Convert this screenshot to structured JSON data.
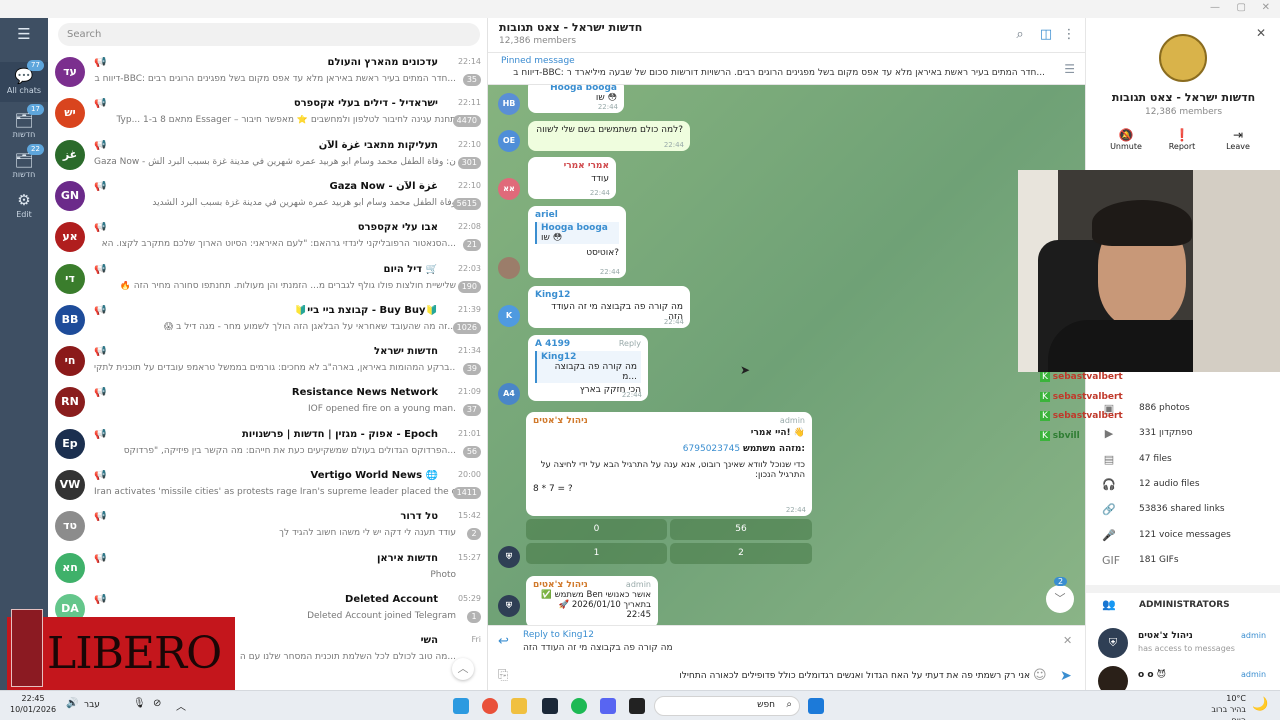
{
  "rail": {
    "items": [
      {
        "label": "All chats",
        "badge": "77"
      },
      {
        "label": "חדשות",
        "badge": "17"
      },
      {
        "label": "חדשות",
        "badge": "22"
      },
      {
        "label": "Edit",
        "badge": ""
      }
    ]
  },
  "search": {
    "placeholder": "Search"
  },
  "chats": [
    {
      "name": "עדכונים מהארץ והעולם",
      "msg": "דיווח ב-BBC: חדר המתים בעיר ראשת באיראן מלא עד אפס מקום בשל מפגינים הרוגים רבים...",
      "time": "22:14",
      "badge": "35",
      "color": "#7b2f8e",
      "initial": "עד"
    },
    {
      "name": "ישראדיל - דילים בעלי אקספרס",
      "msg": "Typ... מתאם 8 ב-1 Essager – תחנת עגינה לחיבור לטלפון ולמחשבים ⭐ מאפשר חיבור",
      "time": "22:11",
      "badge": "4470",
      "color": "#d9441e",
      "initial": "יש"
    },
    {
      "name": "תעליקות מתאבי غزة الآن",
      "msg": "Gaza Now - غزة الآن: وفاة الطفل محمد وسام أبو هربيد عمره شهرين في مدينة غزة بسبب البرد الش...",
      "time": "22:10",
      "badge": "301",
      "color": "#2b6b2b",
      "initial": "غز"
    },
    {
      "name": "Gaza Now - غزة الآن",
      "msg": "وفاة الطفل محمد وسام أبو هربيد عمره شهرين في مدينة غزة بسبب البرد الشديد",
      "time": "22:10",
      "badge": "5615",
      "color": "#6b2a8a",
      "initial": "GN"
    },
    {
      "name": "אבו עלי אקספרס",
      "msg": "הסנאטור הרפובליקני לינדזי גרהאם: \"לעם האיראני: הסיוט הארוך שלכם מתקרב לקצו. הא...",
      "time": "22:08",
      "badge": "21",
      "color": "#b01e1e",
      "initial": "אע"
    },
    {
      "name": "דיל היום 🛒",
      "msg": "🔥 שלישיית חולצות פולו גולף לגברים מ... הזמנתי והן מעולות. תחנתפו סחורה מחיר הזה",
      "time": "22:03",
      "badge": "190",
      "color": "#3a7d2c",
      "initial": "די"
    },
    {
      "name": "🔰קבוצת ביי ביי - Buy Buy🔰",
      "msg": "😱 זה מה שהעובד שאחראי על הבלאגן הזה הולך לשמוע מחר - מגה דיל ב...",
      "time": "21:39",
      "badge": "1026",
      "color": "#1e4c9a",
      "initial": "BB"
    },
    {
      "name": "חדשות ישראל",
      "msg": "ברקע המהומות באיראן, בארה\"ב לא מחכים: גורמים בממשל טראמפ עובדים על תוכנית לתקי...",
      "time": "21:34",
      "badge": "39",
      "color": "#8b1a1a",
      "initial": "חי"
    },
    {
      "name": "Resistance News Network",
      "msg": "IOF opened fire on a young man.",
      "time": "21:09",
      "badge": "37",
      "color": "#8a1d1d",
      "initial": "RN"
    },
    {
      "name": "אפוק - מגזין | חדשות | פרשנויות - Epoch",
      "msg": "הפרדוקס הגדולים בעולם שמשקיעים כעת את חייהם: מה הקשר בין פיזיקה, \"פרדוקס...",
      "time": "21:01",
      "badge": "56",
      "color": "#1b2f4f",
      "initial": "Ep"
    },
    {
      "name": "Vertigo World News 🌐",
      "msg": "Iran activates 'missile cities' as protests rage Iran's supreme leader placed the countr...",
      "time": "20:00",
      "badge": "1411",
      "color": "#333333",
      "initial": "VW"
    },
    {
      "name": "טל דרור",
      "msg": "עודד תענה לי דקה יש לי משהו חשוב להגיד לך",
      "time": "15:42",
      "badge": "2",
      "color": "#8c8c8c",
      "initial": "טד"
    },
    {
      "name": "חדשות איראן",
      "msg": "Photo",
      "time": "15:27",
      "badge": "",
      "color": "#3fb16a",
      "initial": "חא"
    },
    {
      "name": "Deleted Account",
      "msg": "Deleted Account joined Telegram",
      "time": "05:29",
      "badge": "1",
      "color": "#64c68b",
      "initial": "DA"
    },
    {
      "name": "השי",
      "msg": "מה טוב לכולם לכל השלמת תוכנית המסחר שלנו עם ה...",
      "time": "Fri",
      "badge": "",
      "color": "#5b6fa8",
      "initial": "הש"
    }
  ],
  "chat": {
    "title": "חדשות ישראל - צאט תגובות",
    "members": "12,386 members",
    "pinned_label": "Pinned message",
    "pinned_text": "דיווח ב-BBC: חדר המתים בעיר ראשת באיראן מלא עד אפס מקום בשל מפגינים הרוגים רבים. הרשויות דורשות סכום של שבעה מיליארד ר..."
  },
  "messages": {
    "m1": {
      "sender": "Hooga booga",
      "text": "שו 😳",
      "time": "22:44",
      "avatar": "HB"
    },
    "m2": {
      "text": "למה כולם משתמשים בשם שלי לשווה?",
      "time": "22:44",
      "avatar": "OE"
    },
    "m3": {
      "sender": "אמרי אמרי",
      "text": "עודד",
      "time": "22:44",
      "avatar": "אא"
    },
    "m4": {
      "sender": "ariel",
      "quote_sender": "Hooga booga",
      "quote": "שו 😳",
      "text": "אוטיסט?",
      "time": "22:44"
    },
    "m5": {
      "sender": "King12",
      "text": "מה קורה פה בקבוצה מי זה העודד הזה",
      "time": "22:44",
      "avatar": "K"
    },
    "m6": {
      "sender": "A 4199",
      "reply": "Reply",
      "quote_sender": "King12",
      "quote": "מה קורה פה בקבוצה מ...",
      "text": "הכי חזקק בארץ",
      "time": "22:44",
      "avatar": "A4"
    },
    "m7": {
      "sender": "ניהול צ'אטים",
      "role": "admin",
      "l1": "היי אמרי! 👋",
      "l2_label": "מזהה משתמש:",
      "l2_value": "6795023745",
      "l3": "כדי שנוכל לוודא שאינך רובוט, אנא ענה על התרגיל הבא על ידי לחיצה על התרגיל הנכון:",
      "l4": "8 * 7 = ?",
      "time": "22:44"
    },
    "keyboard": [
      "0",
      "56",
      "1",
      "2"
    ],
    "m8": {
      "sender": "ניהול צ'אטים",
      "role": "admin",
      "l1": "✅ משתמש Ben אושר כאנושי",
      "l2": "🚀 בתאריך 2026/01/10 22:45",
      "time": "22:44"
    },
    "unread": "2"
  },
  "reply_bar": {
    "label": "Reply to King12",
    "quote": "מה קורה פה בקבוצה מי זה העודד הזה",
    "input": "אני רק רשמתי פה את דעתי על האח הגדול ואנשים רגדומלים כולל פדופילים לכאורה התחילו"
  },
  "panel": {
    "title": "חדשות ישראל - צאט תגובות",
    "members": "12,386 members",
    "actions": [
      {
        "label": "Unmute",
        "icon": "🔕"
      },
      {
        "label": "Report",
        "icon": "❗"
      },
      {
        "label": "Leave",
        "icon": "⇥"
      }
    ],
    "stats": [
      {
        "label": "886 photos",
        "icon": "photo-icon"
      },
      {
        "label": "ספתקדון 331",
        "icon": "video-icon"
      },
      {
        "label": "47 files",
        "icon": "file-icon"
      },
      {
        "label": "12 audio files",
        "icon": "audio-icon"
      },
      {
        "label": "53836 shared links",
        "icon": "link-icon"
      },
      {
        "label": "121 voice messages",
        "icon": "mic-icon"
      },
      {
        "label": "181 GIFs",
        "icon": "gif-icon"
      }
    ],
    "admins_header": "ADMINISTRATORS",
    "admins": [
      {
        "name": "ניהול צ'אטים",
        "role": "admin",
        "sub": "has access to messages"
      },
      {
        "name": "o o 😈",
        "role": "admin",
        "sub": ""
      }
    ]
  },
  "overlay_chat": [
    "sebastvalbert",
    "sebastvalbert",
    "sebastvalbert",
    "sbvill"
  ],
  "taskbar": {
    "time": "22:45",
    "date": "10/01/2026",
    "lang": "עבר",
    "search": "חפש",
    "weather_temp": "10°C",
    "weather_text": "בהיר ברוב היום"
  },
  "ad": {
    "text": "LIBERO"
  },
  "colors": {
    "accent": "#3a8ed0",
    "rail": "#3e4f63",
    "chat_bg": "#7aa77a"
  }
}
